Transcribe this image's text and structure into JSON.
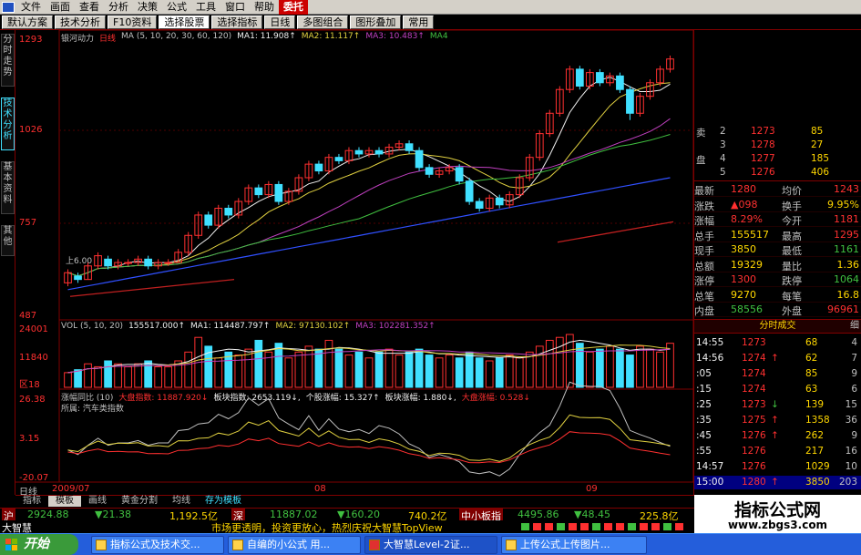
{
  "colors": {
    "up": "#ff3030",
    "down": "#40e0ff",
    "ma1": "#f0f0f0",
    "ma2": "#e0d040",
    "ma3": "#c040c0",
    "ma4": "#40c040",
    "ma5": "#3050ff",
    "text": "#c0c0c0",
    "border": "#800000"
  },
  "menu": {
    "items": [
      "文件",
      "画面",
      "查看",
      "分析",
      "决策",
      "公式",
      "工具",
      "窗口",
      "帮助",
      "委托"
    ],
    "active_index": 9
  },
  "toolbar": {
    "buttons": [
      "默认方案",
      "技术分析",
      "F10资料",
      "选择股票",
      "选择指标",
      "日线",
      "多图组合",
      "图形叠加",
      "常用"
    ],
    "selected_index": 3
  },
  "left_tabs": [
    "分时走势",
    "技术分析",
    "基本资料",
    "其他"
  ],
  "left_tab_active": 1,
  "price_axis": [
    "1293",
    "1026",
    "757",
    "487"
  ],
  "main_legend": {
    "stock": "银河动力",
    "period": "日线",
    "ma": "MA (5, 10, 20, 30, 60, 120)",
    "ma1": "MA1: 11.908↑",
    "ma2": "MA2: 11.117↑",
    "ma3": "MA3: 10.483↑",
    "ma4": "MA4"
  },
  "annot_low": "上6.00",
  "vol_legend": {
    "vol": "VOL (5, 10, 20)",
    "v": "155517.000↑",
    "ma1": "MA1: 114487.797↑",
    "ma2": "MA2: 97130.102↑",
    "ma3": "MA3: 102281.352↑"
  },
  "vol_axis": [
    "24001",
    "11840",
    "区18"
  ],
  "ind_legend": {
    "name": "涨幅同比 (10)",
    "a": "大盘指数: 11887.920↓",
    "b": "板块指数: 2653.119↓,",
    "c": "个股涨幅: 15.327↑",
    "d": "板块涨幅: 1.880↓,",
    "e": "大盘涨幅: 0.528↓"
  },
  "ind_sub": "所属: 汽车类指数",
  "ind_axis": [
    "26.38",
    "3.15",
    "-20.07"
  ],
  "date_labels": [
    "日线",
    "2009/07",
    "08",
    "09"
  ],
  "chart_data": {
    "type": "candlestick",
    "stock": "银河动力",
    "ylim": [
      4.87,
      12.93
    ],
    "candles": [
      [
        5.8,
        6.1,
        5.7,
        6.2
      ],
      [
        6.0,
        5.9,
        5.8,
        6.1
      ],
      [
        5.9,
        6.3,
        5.9,
        6.4
      ],
      [
        6.3,
        6.6,
        6.2,
        6.7
      ],
      [
        6.5,
        6.3,
        6.2,
        6.6
      ],
      [
        6.3,
        6.4,
        6.2,
        6.5
      ],
      [
        6.4,
        6.4,
        6.3,
        6.5
      ],
      [
        6.4,
        6.5,
        6.3,
        6.6
      ],
      [
        6.5,
        6.3,
        6.2,
        6.6
      ],
      [
        6.3,
        6.4,
        6.2,
        6.5
      ],
      [
        6.4,
        6.4,
        6.3,
        6.5
      ],
      [
        6.4,
        6.7,
        6.4,
        6.8
      ],
      [
        6.7,
        7.2,
        6.6,
        7.3
      ],
      [
        7.2,
        7.8,
        7.1,
        7.9
      ],
      [
        7.8,
        7.5,
        7.4,
        7.9
      ],
      [
        7.5,
        8.0,
        7.4,
        8.1
      ],
      [
        8.0,
        7.8,
        7.7,
        8.1
      ],
      [
        7.8,
        8.2,
        7.7,
        8.3
      ],
      [
        8.2,
        8.6,
        8.1,
        8.7
      ],
      [
        8.6,
        8.4,
        8.3,
        8.7
      ],
      [
        8.4,
        8.7,
        8.3,
        8.8
      ],
      [
        8.7,
        8.2,
        8.1,
        8.8
      ],
      [
        8.2,
        8.5,
        8.1,
        8.6
      ],
      [
        8.5,
        8.9,
        8.4,
        9.0
      ],
      [
        8.9,
        9.3,
        8.8,
        9.4
      ],
      [
        9.3,
        9.1,
        9.0,
        9.4
      ],
      [
        9.1,
        9.5,
        9.0,
        9.6
      ],
      [
        9.5,
        9.4,
        9.3,
        9.6
      ],
      [
        9.4,
        9.7,
        9.3,
        9.8
      ],
      [
        9.7,
        9.6,
        9.5,
        9.8
      ],
      [
        9.6,
        9.7,
        9.5,
        9.8
      ],
      [
        9.7,
        9.6,
        9.5,
        9.8
      ],
      [
        9.6,
        9.8,
        9.5,
        9.9
      ],
      [
        9.8,
        9.9,
        9.7,
        10.0
      ],
      [
        9.9,
        9.7,
        9.6,
        10.0
      ],
      [
        9.7,
        9.2,
        9.1,
        9.8
      ],
      [
        9.2,
        9.0,
        8.9,
        9.3
      ],
      [
        9.0,
        9.1,
        8.9,
        9.2
      ],
      [
        9.1,
        9.2,
        9.0,
        9.3
      ],
      [
        9.2,
        8.8,
        8.7,
        9.3
      ],
      [
        8.8,
        8.2,
        8.1,
        8.9
      ],
      [
        8.2,
        8.0,
        7.9,
        8.3
      ],
      [
        8.0,
        8.3,
        7.9,
        8.4
      ],
      [
        8.3,
        8.1,
        8.0,
        8.4
      ],
      [
        8.1,
        8.4,
        8.0,
        8.5
      ],
      [
        8.4,
        8.9,
        8.3,
        9.0
      ],
      [
        8.9,
        9.5,
        8.8,
        9.6
      ],
      [
        9.5,
        10.2,
        9.4,
        10.3
      ],
      [
        10.2,
        10.8,
        10.1,
        10.9
      ],
      [
        10.8,
        11.5,
        10.7,
        11.6
      ],
      [
        11.5,
        12.1,
        11.4,
        12.2
      ],
      [
        12.1,
        11.6,
        11.5,
        12.2
      ],
      [
        11.6,
        12.0,
        11.5,
        12.1
      ],
      [
        12.0,
        11.7,
        11.6,
        12.1
      ],
      [
        11.7,
        11.9,
        11.6,
        12.0
      ],
      [
        11.9,
        11.5,
        11.4,
        12.0
      ],
      [
        11.5,
        10.8,
        10.6,
        11.6
      ],
      [
        10.8,
        11.3,
        10.7,
        11.4
      ],
      [
        11.3,
        11.7,
        11.2,
        11.8
      ],
      [
        11.7,
        12.1,
        11.6,
        12.2
      ],
      [
        12.1,
        12.4,
        12.0,
        12.5
      ]
    ],
    "volume": [
      5,
      6,
      8,
      7,
      9,
      8,
      7,
      8,
      9,
      7,
      7,
      9,
      12,
      17,
      14,
      10,
      12,
      11,
      13,
      16,
      12,
      15,
      10,
      12,
      14,
      13,
      16,
      13,
      11,
      12,
      10,
      12,
      13,
      11,
      12,
      13,
      11,
      10,
      11,
      10,
      12,
      10,
      9,
      10,
      11,
      10,
      12,
      14,
      16,
      17,
      18,
      15,
      12,
      13,
      14,
      13,
      11,
      14,
      13,
      12,
      15
    ],
    "ind_series": [
      {
        "name": "个股涨幅",
        "color": "#c0c0c0"
      },
      {
        "name": "板块涨幅",
        "color": "#e0d040"
      },
      {
        "name": "大盘涨幅",
        "color": "#ff3030"
      }
    ]
  },
  "orderbook": [
    {
      "side": "卖",
      "n": "2",
      "price": "1273",
      "vol": "85",
      "color": "#ff3030"
    },
    {
      "side": "",
      "n": "3",
      "price": "1278",
      "vol": "27",
      "color": "#ff3030"
    },
    {
      "side": "盘",
      "n": "4",
      "price": "1277",
      "vol": "185",
      "color": "#ff3030"
    },
    {
      "side": "",
      "n": "5",
      "price": "1276",
      "vol": "406",
      "color": "#ff3030"
    }
  ],
  "stats": [
    {
      "l1": "最新",
      "v1": "1280",
      "c1": "#ff3030",
      "l2": "均价",
      "v2": "1243",
      "c2": "#ff3030"
    },
    {
      "l1": "涨跌",
      "v1": "▲098",
      "c1": "#ff3030",
      "l2": "换手",
      "v2": "9.95%",
      "c2": "#ffd700"
    },
    {
      "l1": "涨幅",
      "v1": "8.29%",
      "c1": "#ff3030",
      "l2": "今开",
      "v2": "1181",
      "c2": "#ff3030"
    },
    {
      "l1": "总手",
      "v1": "155517",
      "c1": "#ffd700",
      "l2": "最高",
      "v2": "1295",
      "c2": "#ff3030"
    },
    {
      "l1": "现手",
      "v1": "3850",
      "c1": "#ffd700",
      "l2": "最低",
      "v2": "1161",
      "c2": "#40c040"
    },
    {
      "l1": "总额",
      "v1": "19329",
      "c1": "#ffd700",
      "l2": "量比",
      "v2": "1.36",
      "c2": "#ffd700"
    },
    {
      "l1": "涨停",
      "v1": "1300",
      "c1": "#ff3030",
      "l2": "跌停",
      "v2": "1064",
      "c2": "#40c040"
    },
    {
      "l1": "总笔",
      "v1": "9270",
      "c1": "#ffd700",
      "l2": "每笔",
      "v2": "16.8",
      "c2": "#ffd700"
    },
    {
      "l1": "内盘",
      "v1": "58556",
      "c1": "#40c040",
      "l2": "外盘",
      "v2": "96961",
      "c2": "#ff3030"
    }
  ],
  "trade_header": "分时成交",
  "trade_header_tab": "细",
  "trades": [
    {
      "t": "14:55",
      "p": "1273",
      "a": "",
      "v": "68",
      "n": "4",
      "pc": "#ff3030",
      "ac": "#ff3030"
    },
    {
      "t": "14:56",
      "p": "1274",
      "a": "↑",
      "v": "62",
      "n": "7",
      "pc": "#ff3030",
      "ac": "#ff3030"
    },
    {
      "t": ":05",
      "p": "1274",
      "a": "",
      "v": "85",
      "n": "9",
      "pc": "#ff3030",
      "ac": "#ff3030"
    },
    {
      "t": ":15",
      "p": "1274",
      "a": "",
      "v": "63",
      "n": "6",
      "pc": "#ff3030",
      "ac": "#ff3030"
    },
    {
      "t": ":25",
      "p": "1273",
      "a": "↓",
      "v": "139",
      "n": "15",
      "pc": "#ff3030",
      "ac": "#40c040"
    },
    {
      "t": ":35",
      "p": "1275",
      "a": "↑",
      "v": "1358",
      "n": "36",
      "pc": "#ff3030",
      "ac": "#ff3030"
    },
    {
      "t": ":45",
      "p": "1276",
      "a": "↑",
      "v": "262",
      "n": "9",
      "pc": "#ff3030",
      "ac": "#ff3030"
    },
    {
      "t": ":55",
      "p": "1276",
      "a": "",
      "v": "217",
      "n": "16",
      "pc": "#ff3030",
      "ac": "#ff3030"
    },
    {
      "t": "14:57",
      "p": "1276",
      "a": "",
      "v": "1029",
      "n": "10",
      "pc": "#ff3030",
      "ac": "#ff3030"
    },
    {
      "t": "15:00",
      "p": "1280",
      "a": "↑",
      "v": "3850",
      "n": "203",
      "pc": "#ff3030",
      "ac": "#ff3030"
    }
  ],
  "bottom_tabs": [
    "指标",
    "模板",
    "画线",
    "黄金分割",
    "均线",
    "存为模板"
  ],
  "bottom_active": 1,
  "ticker": {
    "sh_label": "沪",
    "sh_idx": "2924.88",
    "sh_chg": "▼21.38",
    "sh_amt": "1,192.5亿",
    "sz_label": "深",
    "sz_idx": "11887.02",
    "sz_chg": "▼160.20",
    "sz_amt": "740.2亿",
    "zx_label": "中小板指",
    "zx_idx": "4495.86",
    "zx_chg": "▼48.45",
    "zx_amt": "225.8亿"
  },
  "news": {
    "brand": "大智慧",
    "text": "市场更透明，投资更放心，热烈庆祝大智慧TopView"
  },
  "watermark": {
    "title": "指标公式网",
    "url": "www.zbgs3.com"
  },
  "taskbar": {
    "start": "开始",
    "tasks": [
      "指标公式及技术交...",
      "自编的小公式 用...",
      "大智慧Level-2证...",
      "上传公式上传图片..."
    ]
  }
}
